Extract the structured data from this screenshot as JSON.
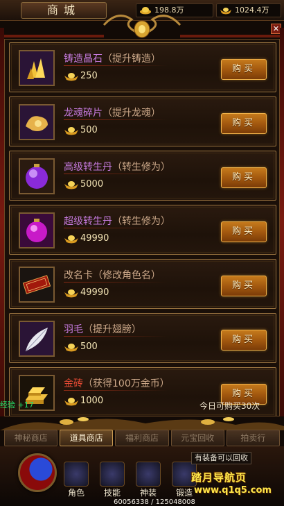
{
  "header": {
    "title": "商城",
    "currencies": [
      {
        "icon": "yuanbao-bag-icon",
        "value": "198.8万"
      },
      {
        "icon": "gold-ingot-icon",
        "value": "1024.4万"
      }
    ],
    "close_icon": "close-icon"
  },
  "items": [
    {
      "name": "铸造晶石",
      "desc": "（提升铸造）",
      "name_color": "#c77be0",
      "price": "250",
      "icon": "golden-crystal-icon",
      "button": "购买"
    },
    {
      "name": "龙魂碎片",
      "desc": "（提升龙魂）",
      "name_color": "#c77be0",
      "price": "500",
      "icon": "dragon-soul-fragment-icon",
      "button": "购买"
    },
    {
      "name": "高级转生丹",
      "desc": "（转生修为）",
      "name_color": "#c77be0",
      "price": "5000",
      "icon": "purple-pill-icon",
      "button": "购买"
    },
    {
      "name": "超级转生丹",
      "desc": "（转生修为）",
      "name_color": "#c77be0",
      "price": "49990",
      "icon": "magenta-pill-icon",
      "button": "购买"
    },
    {
      "name": "改名卡",
      "desc": "（修改角色名）",
      "name_color": "#cda98a",
      "price": "49990",
      "icon": "rename-card-icon",
      "button": "购买"
    },
    {
      "name": "羽毛",
      "desc": "（提升翅膀）",
      "name_color": "#c77be0",
      "price": "500",
      "icon": "feather-icon",
      "button": "购买"
    },
    {
      "name": "金砖",
      "desc": "（获得100万金币）",
      "name_color": "#e34a34",
      "price": "1000",
      "icon": "gold-bars-icon",
      "button": "购买"
    }
  ],
  "daily_limit": "今日可购买30次",
  "exp_text": "经验 +17",
  "tabs": [
    {
      "label": "神秘商店",
      "active": false
    },
    {
      "label": "道具商店",
      "active": true
    },
    {
      "label": "福利商店",
      "active": false
    },
    {
      "label": "元宝回收",
      "active": false
    },
    {
      "label": "拍卖行",
      "active": false
    }
  ],
  "bottom": {
    "skills": [
      {
        "label": "角色",
        "icon": "character-icon"
      },
      {
        "label": "技能",
        "icon": "skill-book-icon"
      },
      {
        "label": "神装",
        "icon": "divine-armor-icon"
      },
      {
        "label": "锻造",
        "icon": "forge-icon"
      }
    ],
    "notice": "有装备可以回收",
    "watermark_title": "踏月导航页",
    "watermark_url": "www.q1q5.com",
    "stats": "60056338 / 125048008"
  }
}
